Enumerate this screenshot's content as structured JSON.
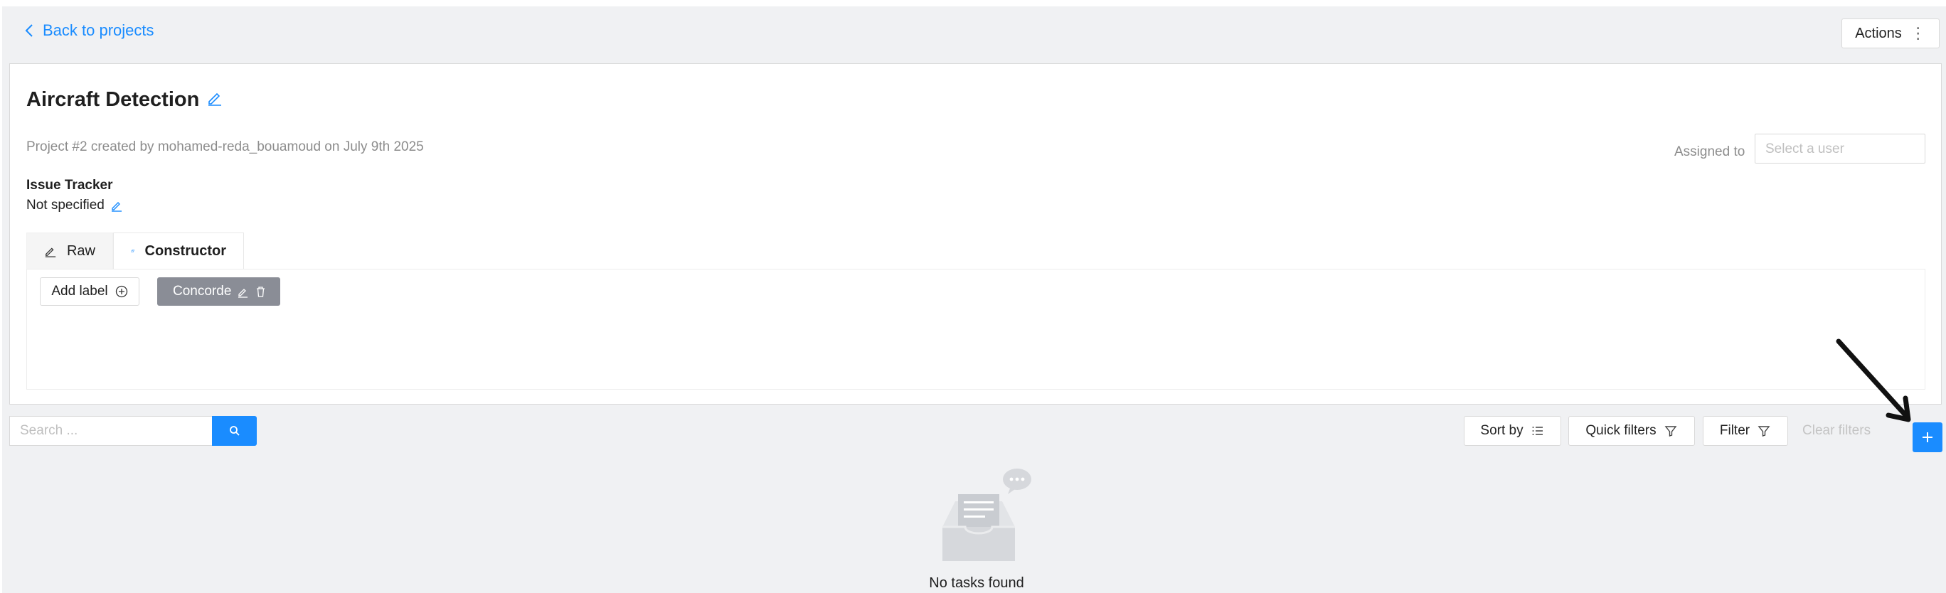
{
  "header": {
    "back_label": "Back to projects",
    "actions_label": "Actions"
  },
  "project": {
    "title": "Aircraft Detection",
    "subtitle": "Project #2 created by mohamed-reda_bouamoud on July 9th 2025",
    "assigned_label": "Assigned to",
    "assigned_placeholder": "Select a user",
    "issue_tracker_label": "Issue Tracker",
    "issue_tracker_value": "Not specified"
  },
  "tabs": [
    {
      "label": "Raw",
      "icon": "pencil-icon"
    },
    {
      "label": "Constructor",
      "icon": "constructor-icon",
      "active": true
    }
  ],
  "labels_panel": {
    "add_label": "Add label",
    "labels": [
      {
        "name": "Concorde",
        "color": "#8a8d96"
      }
    ]
  },
  "toolbar": {
    "search_placeholder": "Search ...",
    "sort_by": "Sort by",
    "quick_filters": "Quick filters",
    "filter": "Filter",
    "clear_filters": "Clear filters"
  },
  "empty_state": {
    "text": "No tasks found"
  },
  "colors": {
    "accent": "#1a8cff",
    "label_tag": "#8a8d96",
    "background": "#f0f1f3"
  }
}
